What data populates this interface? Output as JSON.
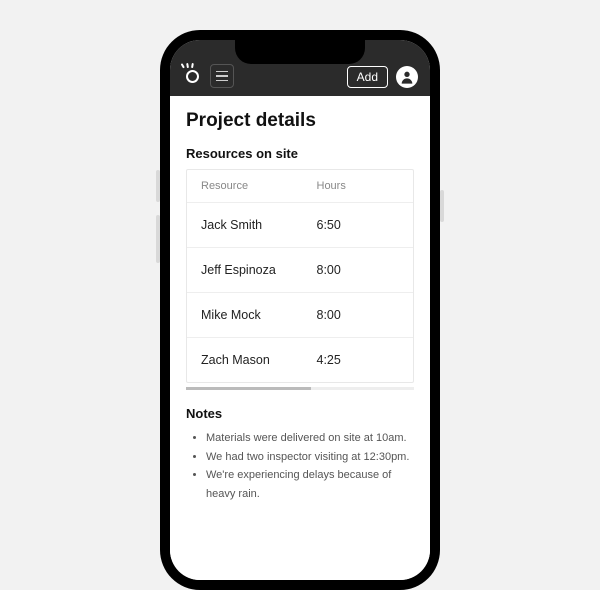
{
  "header": {
    "add_label": "Add"
  },
  "page": {
    "title": "Project details"
  },
  "resources": {
    "section_title": "Resources on site",
    "columns": {
      "resource": "Resource",
      "hours": "Hours"
    },
    "rows": [
      {
        "name": "Jack Smith",
        "hours": "6:50"
      },
      {
        "name": "Jeff Espinoza",
        "hours": "8:00"
      },
      {
        "name": "Mike Mock",
        "hours": "8:00"
      },
      {
        "name": "Zach Mason",
        "hours": "4:25"
      }
    ]
  },
  "notes": {
    "section_title": "Notes",
    "items": [
      "Materials were delivered on site at 10am.",
      "We had two inspector visiting at 12:30pm.",
      "We're experiencing delays because of heavy rain."
    ]
  }
}
